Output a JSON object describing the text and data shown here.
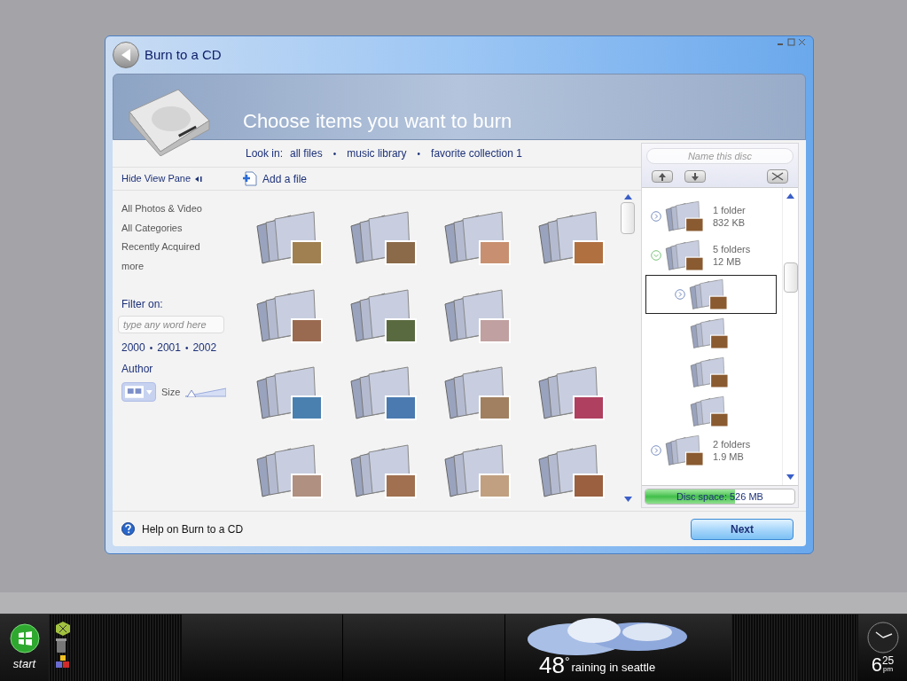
{
  "window": {
    "title": "Burn to a CD"
  },
  "header": {
    "heading": "Choose items you want to burn"
  },
  "look_in": {
    "label": "Look in:",
    "items": [
      {
        "kind": "link",
        "text": "all files"
      },
      {
        "kind": "separator",
        "text": "•"
      },
      {
        "kind": "link",
        "text": "music library"
      },
      {
        "kind": "separator",
        "text": "•"
      },
      {
        "kind": "link",
        "text": "favorite collection 1"
      }
    ]
  },
  "toolbar": {
    "hide_view_pane": "Hide View Pane",
    "add_file": "Add a file"
  },
  "sidebar": {
    "items": [
      "All Photos & Video",
      "All Categories",
      "Recently Acquired",
      "more"
    ],
    "filter": {
      "label": "Filter on:",
      "placeholder": "type any word here"
    },
    "years": [
      {
        "kind": "link",
        "text": "2000"
      },
      {
        "kind": "separator",
        "text": "•"
      },
      {
        "kind": "link",
        "text": "2001"
      },
      {
        "kind": "separator",
        "text": "•"
      },
      {
        "kind": "link",
        "text": "2002"
      }
    ],
    "author": "Author",
    "size_slider": {
      "label": "Size",
      "level": 0.05
    }
  },
  "disc": {
    "name_placeholder": "Name this disc",
    "entries": [
      {
        "kind": "group",
        "expanded": false,
        "selected": false,
        "lines": [
          "1 folder",
          "832 KB"
        ]
      },
      {
        "kind": "group",
        "expanded": true,
        "selected": false,
        "lines": [
          "5 folders",
          "12 MB"
        ],
        "children": [
          {
            "kind": "group",
            "expanded": false,
            "selected": true
          },
          {
            "kind": "item",
            "selected": false
          },
          {
            "kind": "item",
            "selected": false
          },
          {
            "kind": "item",
            "selected": false
          }
        ]
      },
      {
        "kind": "group",
        "expanded": false,
        "selected": false,
        "lines": [
          "2 folders",
          "1.9 MB"
        ]
      }
    ],
    "disc_space": {
      "label": "Disc space: 526 MB",
      "level": 0.6
    }
  },
  "footer": {
    "help": "Help on Burn to a CD",
    "next": "Next"
  },
  "taskbar": {
    "start": "start",
    "temperature": "48",
    "degree": "°",
    "weather": "raining in seattle",
    "time_hour": "6",
    "time_minutes": "25",
    "time_period": "pm"
  }
}
